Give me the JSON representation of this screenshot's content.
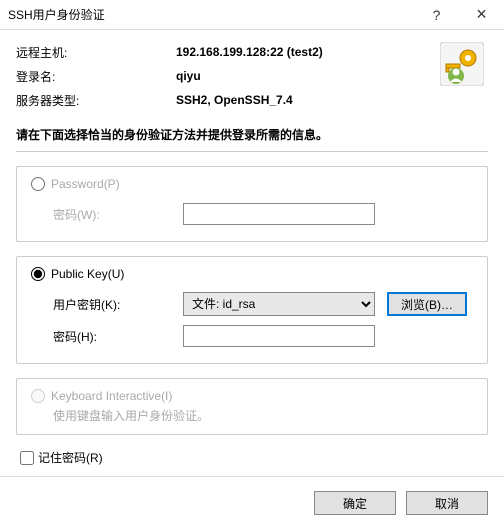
{
  "titlebar": {
    "title": "SSH用户身份验证",
    "help": "?",
    "close": "×"
  },
  "info": {
    "remote_host_label": "远程主机:",
    "remote_host_value": "192.168.199.128:22 (test2)",
    "login_label": "登录名:",
    "login_value": "qiyu",
    "server_type_label": "服务器类型:",
    "server_type_value": "SSH2, OpenSSH_7.4"
  },
  "instruction": "请在下面选择恰当的身份验证方法并提供登录所需的信息。",
  "password_section": {
    "radio_label": "Password(P)",
    "pw_label": "密码(W):"
  },
  "pubkey_section": {
    "radio_label": "Public Key(U)",
    "userkey_label": "用户密钥(K):",
    "select_value": "文件: id_rsa",
    "browse_label": "浏览(B)…",
    "pw_label": "密码(H):"
  },
  "ki_section": {
    "radio_label": "Keyboard Interactive(I)",
    "sub": "使用键盘输入用户身份验证。"
  },
  "remember_label": "记住密码(R)",
  "buttons": {
    "ok": "确定",
    "cancel": "取消"
  }
}
